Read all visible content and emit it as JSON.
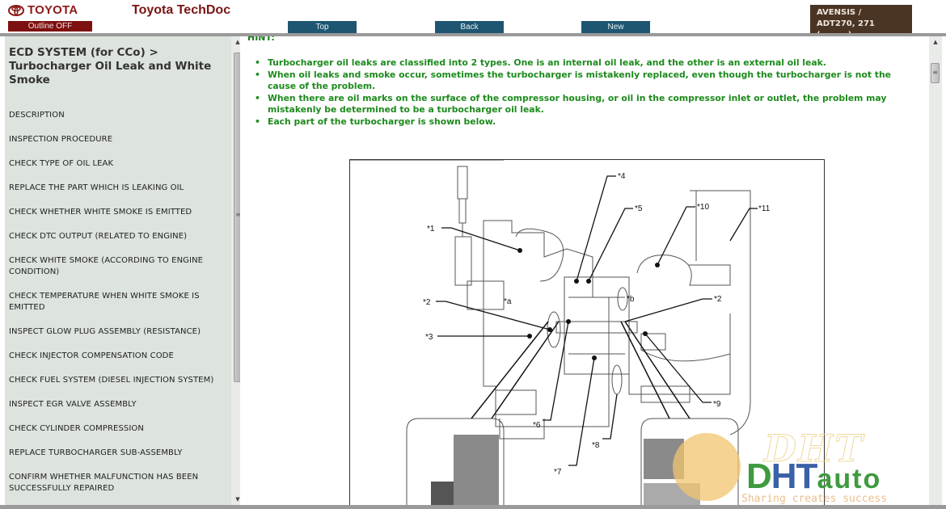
{
  "header": {
    "brand": "TOYOTA",
    "app_title": "Toyota TechDoc",
    "outline_toggle": "Outline OFF",
    "nav": {
      "top": "Top",
      "back": "Back",
      "new": "New"
    },
    "vehicle": {
      "line1": "AVENSIS /",
      "line2": "ADT270, 271",
      "line3": "(.........)"
    }
  },
  "sidebar": {
    "heading": "ECD SYSTEM (for CCo) > Turbocharger Oil Leak and White Smoke",
    "items": [
      {
        "label": "DESCRIPTION"
      },
      {
        "label": "INSPECTION PROCEDURE"
      },
      {
        "label": "CHECK TYPE OF OIL LEAK"
      },
      {
        "label": "REPLACE THE PART WHICH IS LEAKING OIL"
      },
      {
        "label": "CHECK WHETHER WHITE SMOKE IS EMITTED"
      },
      {
        "label": "CHECK DTC OUTPUT (RELATED TO ENGINE)"
      },
      {
        "label": "CHECK WHITE SMOKE (ACCORDING TO ENGINE CONDITION)"
      },
      {
        "label": "CHECK TEMPERATURE WHEN WHITE SMOKE IS EMITTED"
      },
      {
        "label": "INSPECT GLOW PLUG ASSEMBLY (RESISTANCE)"
      },
      {
        "label": "CHECK INJECTOR COMPENSATION CODE"
      },
      {
        "label": "CHECK FUEL SYSTEM (DIESEL INJECTION SYSTEM)"
      },
      {
        "label": "INSPECT EGR VALVE ASSEMBLY"
      },
      {
        "label": "CHECK CYLINDER COMPRESSION"
      },
      {
        "label": "REPLACE TURBOCHARGER SUB-ASSEMBLY"
      },
      {
        "label": "CONFIRM WHETHER MALFUNCTION HAS BEEN SUCCESSFULLY REPAIRED"
      }
    ],
    "scroll_position": 0.0
  },
  "main": {
    "hint_label": "HINT:",
    "hints": [
      "Turbocharger oil leaks are classified into 2 types. One is an internal oil leak, and the other is an external oil leak.",
      "When oil leaks and smoke occur, sometimes the turbocharger is mistakenly replaced, even though the turbocharger is not the cause of the problem.",
      "When there are oil marks on the surface of the compressor housing, or oil in the compressor inlet or outlet, the problem may mistakenly be determined to be a turbocharger oil leak.",
      "Each part of the turbocharger is shown below."
    ],
    "diagram": {
      "callouts": [
        "*1",
        "*2",
        "*3",
        "*4",
        "*5",
        "*6",
        "*7",
        "*8",
        "*9",
        "*10",
        "*11",
        "*2",
        "*a",
        "*b"
      ]
    }
  },
  "watermark": {
    "ghost": "DHT",
    "brand_d": "D",
    "brand_ht": "HT",
    "brand_auto": "auto",
    "tagline": "Sharing creates success"
  },
  "icons": {
    "brand_logo": "toyota-emblem-icon",
    "scroll_up": "▲",
    "scroll_down": "▼",
    "grip": "≡"
  }
}
